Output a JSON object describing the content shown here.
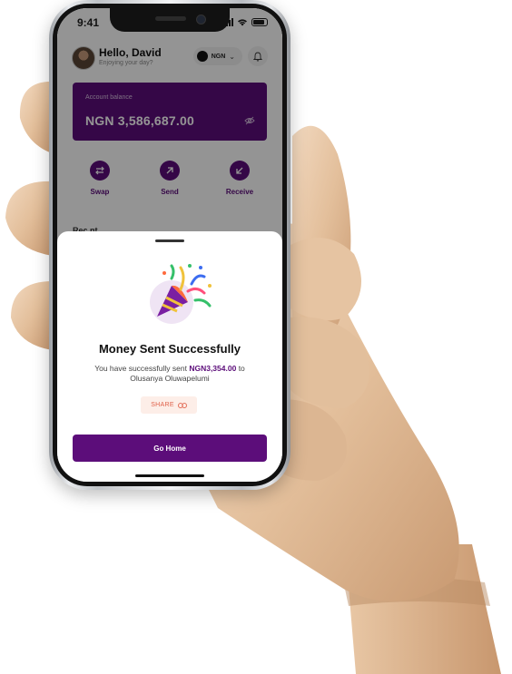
{
  "status_bar": {
    "time": "9:41"
  },
  "header": {
    "greeting": "Hello, David",
    "subtitle": "Enjoying your day?",
    "currency": "NGN"
  },
  "balance": {
    "label": "Account balance",
    "amount": "NGN 3,586,687.00"
  },
  "actions": [
    {
      "label": "Swap",
      "icon": "swap-icon"
    },
    {
      "label": "Send",
      "icon": "arrow-up-right-icon"
    },
    {
      "label": "Receive",
      "icon": "arrow-down-left-icon"
    }
  ],
  "section_peek": "Rec  nt  ",
  "modal": {
    "title": "Money Sent Successfully",
    "message_prefix": "You have successfully sent",
    "amount": "NGN3,354.00",
    "message_suffix": "to",
    "recipient": "Olusanya Oluwapelumi",
    "share_label": "SHARE",
    "primary_button": "Go Home",
    "illustration": "party-popper-icon"
  },
  "colors": {
    "brand": "#5c0d7a",
    "share_text": "#e0614a",
    "share_bg": "#fdeee8"
  }
}
